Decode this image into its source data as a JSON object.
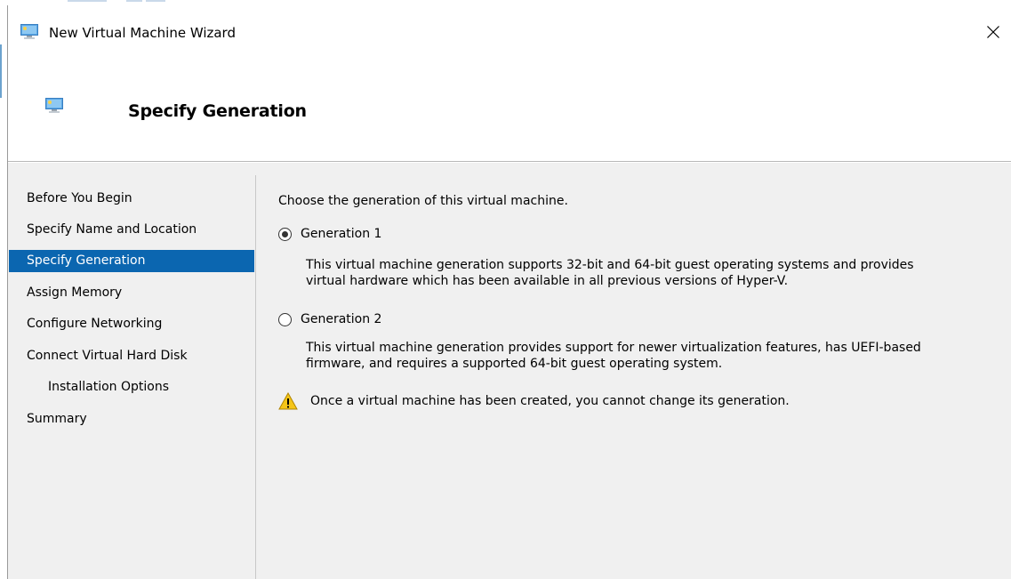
{
  "window": {
    "title": "New Virtual Machine Wizard",
    "icon": "hyper-v-vm-icon"
  },
  "header": {
    "title": "Specify Generation",
    "icon": "hyper-v-vm-icon"
  },
  "nav": {
    "items": [
      {
        "label": "Before You Begin",
        "active": false,
        "indent": false
      },
      {
        "label": "Specify Name and Location",
        "active": false,
        "indent": false
      },
      {
        "label": "Specify Generation",
        "active": true,
        "indent": false
      },
      {
        "label": "Assign Memory",
        "active": false,
        "indent": false
      },
      {
        "label": "Configure Networking",
        "active": false,
        "indent": false
      },
      {
        "label": "Connect Virtual Hard Disk",
        "active": false,
        "indent": false
      },
      {
        "label": "Installation Options",
        "active": false,
        "indent": true
      },
      {
        "label": "Summary",
        "active": false,
        "indent": false
      }
    ]
  },
  "content": {
    "prompt": "Choose the generation of this virtual machine.",
    "options": [
      {
        "label": "Generation 1",
        "selected": true,
        "description_line1": "This virtual machine generation supports 32-bit and 64-bit guest operating systems and provides",
        "description_line2": "virtual hardware which has been available in all previous versions of Hyper-V."
      },
      {
        "label": "Generation 2",
        "selected": false,
        "description_line1": "This virtual machine generation provides support for newer virtualization features, has UEFI-based",
        "description_line2": "firmware, and requires a supported 64-bit guest operating system."
      }
    ],
    "warning": "Once a virtual machine has been created, you cannot change its generation.",
    "warning_icon": "warning-triangle-icon"
  },
  "colors": {
    "selection": "#0b66b0",
    "panel_bg": "#f0f0f0",
    "warning_fill": "#f5c518"
  }
}
